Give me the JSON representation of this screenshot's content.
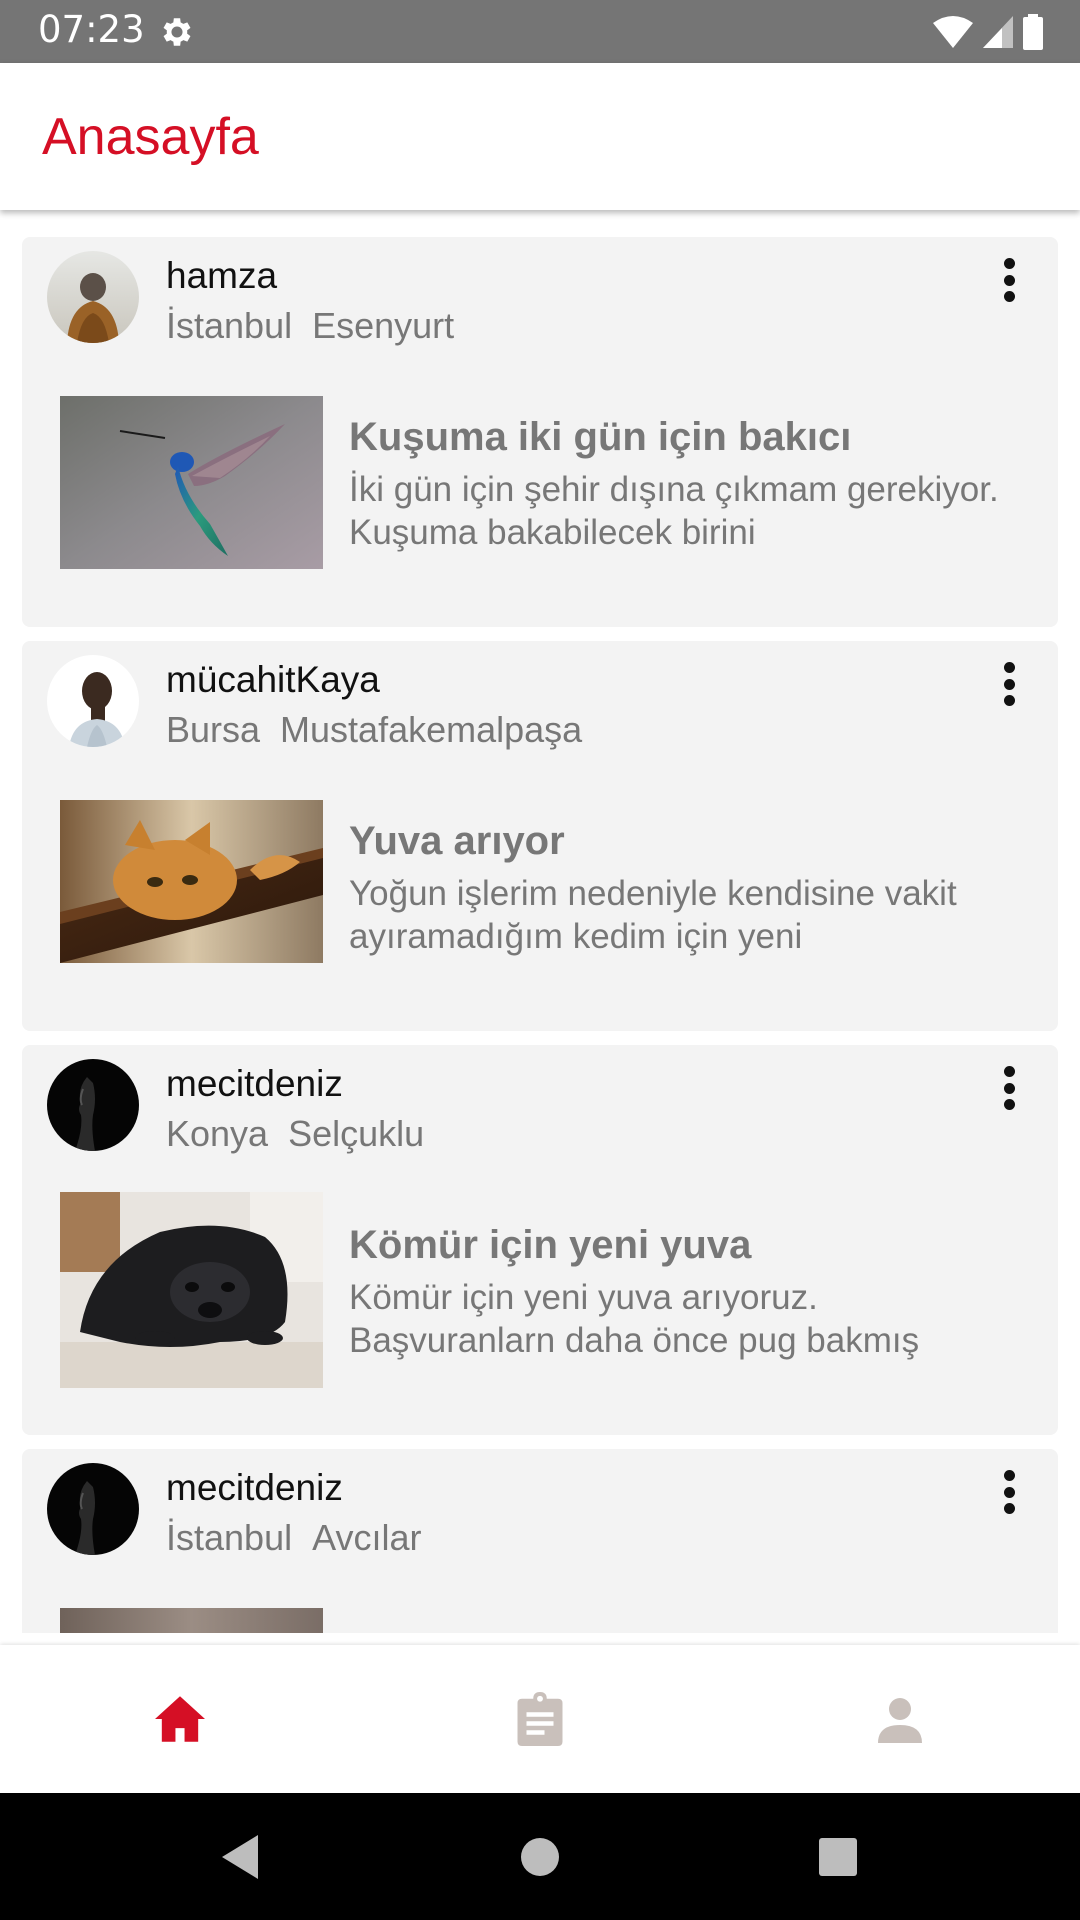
{
  "status_bar": {
    "time": "07:23",
    "icons": [
      "gear-icon",
      "wifi-icon",
      "cell-signal-icon",
      "battery-icon"
    ]
  },
  "app_bar": {
    "title": "Anasayfa",
    "title_color": "#d50f25"
  },
  "posts": [
    {
      "username": "hamza",
      "city": "İstanbul",
      "district": "Esenyurt",
      "avatar": "person-in-hood-photo",
      "image": "hummingbird-photo",
      "title": "Kuşuma iki gün için bakıcı",
      "body": "İki gün için şehir dışına çıkmam gerekiyor. Kuşuma bakabilecek birini"
    },
    {
      "username": "mücahitKaya",
      "city": "Bursa",
      "district": "Mustafakemalpaşa",
      "avatar": "man-profile-photo",
      "image": "orange-cat-photo",
      "title": "Yuva arıyor",
      "body": "Yoğun işlerim nedeniyle kendisine vakit ayıramadığım kedim için yeni"
    },
    {
      "username": "mecitdeniz",
      "city": "Konya",
      "district": "Selçuklu",
      "avatar": "dark-silhouette-photo",
      "image": "black-pug-photo",
      "title": "Kömür için yeni yuva",
      "body": "Kömür için yeni yuva arıyoruz. Başvuranlarn  daha önce pug bakmış"
    },
    {
      "username": "mecitdeniz",
      "city": "İstanbul",
      "district": "Avcılar",
      "avatar": "dark-silhouette-photo",
      "image": "partially-visible-photo",
      "title": "",
      "body": ""
    }
  ],
  "bottom_nav": {
    "items": [
      {
        "icon": "home-icon",
        "active": true
      },
      {
        "icon": "clipboard-icon",
        "active": false
      },
      {
        "icon": "person-icon",
        "active": false
      }
    ],
    "active_color": "#d50f25",
    "inactive_color": "#c9c0bb"
  },
  "system_nav": [
    "back-icon",
    "home-circle-icon",
    "recents-icon"
  ]
}
